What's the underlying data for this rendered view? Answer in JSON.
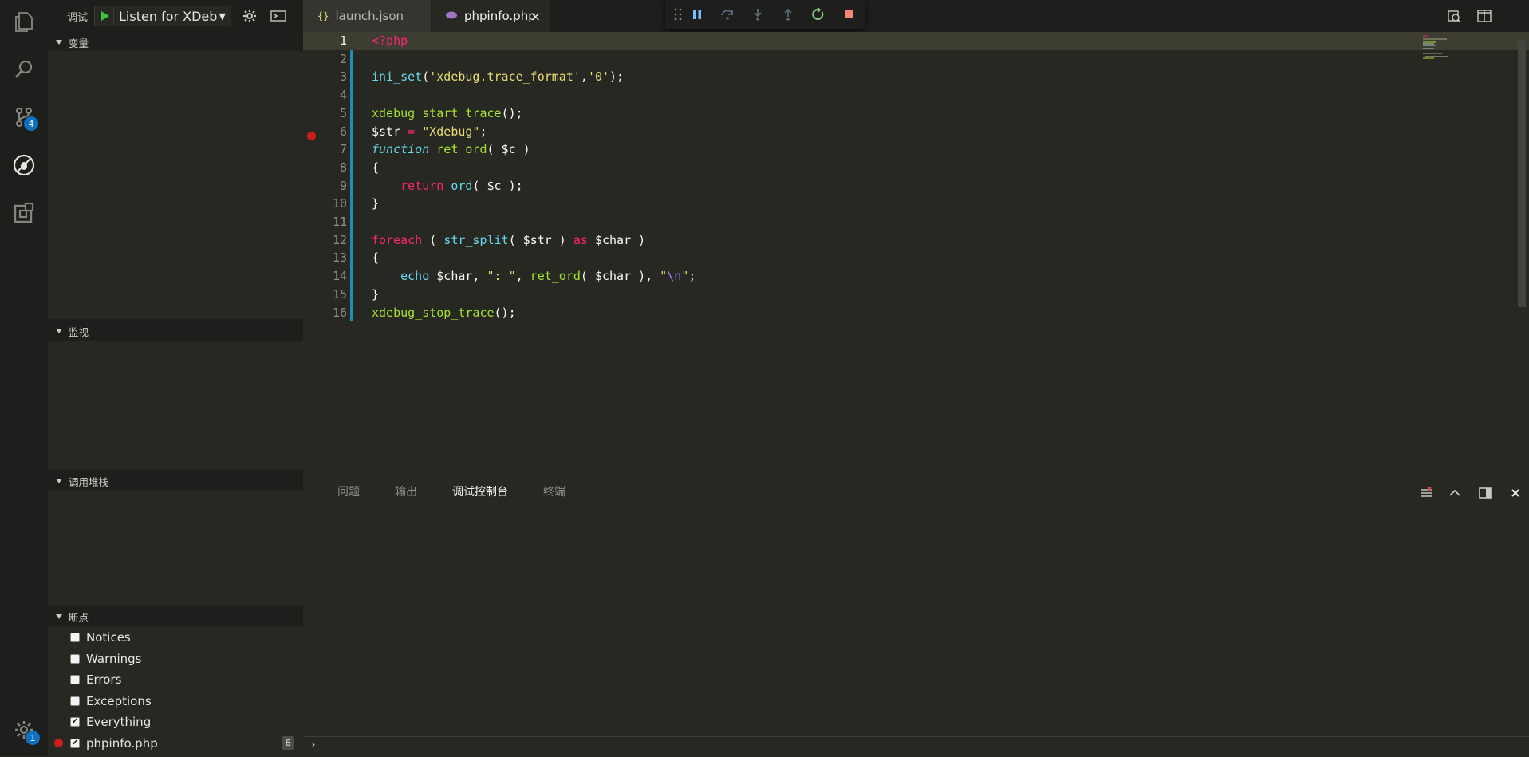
{
  "sidebar": {
    "debug_title": "调试",
    "config": "Listen for XDebu",
    "sections": {
      "variables": "变量",
      "watch": "监视",
      "callstack": "调用堆栈",
      "breakpoints": "断点"
    },
    "breakpoints": [
      {
        "label": "Notices",
        "checked": false
      },
      {
        "label": "Warnings",
        "checked": false
      },
      {
        "label": "Errors",
        "checked": false
      },
      {
        "label": "Exceptions",
        "checked": false
      },
      {
        "label": "Everything",
        "checked": true
      },
      {
        "label": "phpinfo.php",
        "checked": true,
        "line": "6"
      }
    ]
  },
  "activity": {
    "scm_badge": "4",
    "settings_badge": "1"
  },
  "tabs": {
    "launch": {
      "label": "launch.json",
      "icon": "{}"
    },
    "php": {
      "label": "phpinfo.php",
      "close": "×"
    }
  },
  "editor": {
    "line_numbers": [
      "1",
      "2",
      "3",
      "4",
      "5",
      "6",
      "7",
      "8",
      "9",
      "10",
      "11",
      "12",
      "13",
      "14",
      "15",
      "16"
    ]
  },
  "panel": {
    "tabs": [
      "问题",
      "输出",
      "调试控制台",
      "终端"
    ],
    "repl_prompt": "›"
  },
  "colors": {
    "accent": "#0e70c0",
    "breakpoint": "#cd1e1e",
    "background": "#272822"
  }
}
